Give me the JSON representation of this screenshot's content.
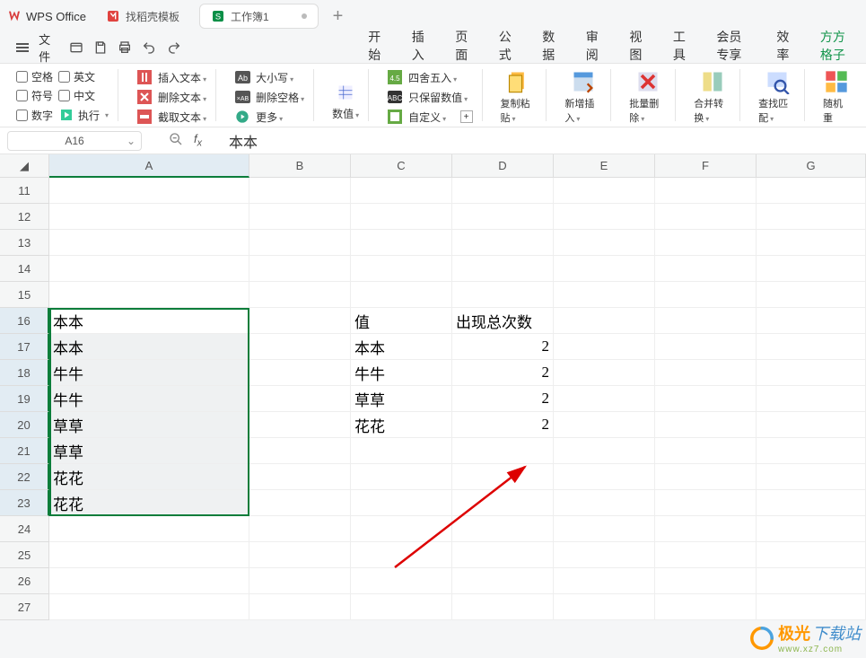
{
  "title_tabs": {
    "logo": "WPS Office",
    "template_tab": "找稻壳模板",
    "active_doc": "工作簿1"
  },
  "quickbar": {
    "file": "文件"
  },
  "menutabs": [
    "开始",
    "插入",
    "页面",
    "公式",
    "数据",
    "审阅",
    "视图",
    "工具",
    "会员专享",
    "效率",
    "方方格子"
  ],
  "menutab_active_index": 10,
  "ribbon": {
    "chk": {
      "blank": "空格",
      "eng": "英文",
      "sym": "符号",
      "chi": "中文",
      "num": "数字",
      "exec": "执行"
    },
    "t": {
      "insert": "插入文本",
      "del": "删除文本",
      "extract": "截取文本",
      "caps": "大小写",
      "delsp": "删除空格",
      "more": "更多",
      "num": "数值",
      "round": "四舍五入",
      "keep": "只保留数值",
      "custom": "自定义",
      "copy": "复制粘贴",
      "new": "新增插入",
      "bdel": "批量删除",
      "merge": "合并转换",
      "find": "查找匹配",
      "rand": "随机重"
    }
  },
  "namebox": {
    "ref": "A16",
    "fx": "本本"
  },
  "cols": [
    "A",
    "B",
    "C",
    "D",
    "E",
    "F",
    "G"
  ],
  "rows": [
    11,
    12,
    13,
    14,
    15,
    16,
    17,
    18,
    19,
    20,
    21,
    22,
    23,
    24,
    25,
    26,
    27
  ],
  "cells": {
    "a": [
      "本本",
      "本本",
      "牛牛",
      "牛牛",
      "草草",
      "草草",
      "花花",
      "花花"
    ],
    "c": [
      "值",
      "本本",
      "牛牛",
      "草草",
      "花花"
    ],
    "d": [
      "出现总次数",
      "2",
      "2",
      "2",
      "2"
    ]
  },
  "watermark": {
    "main": "极光",
    "sub": "下载站",
    "url": "www.xz7.com"
  }
}
